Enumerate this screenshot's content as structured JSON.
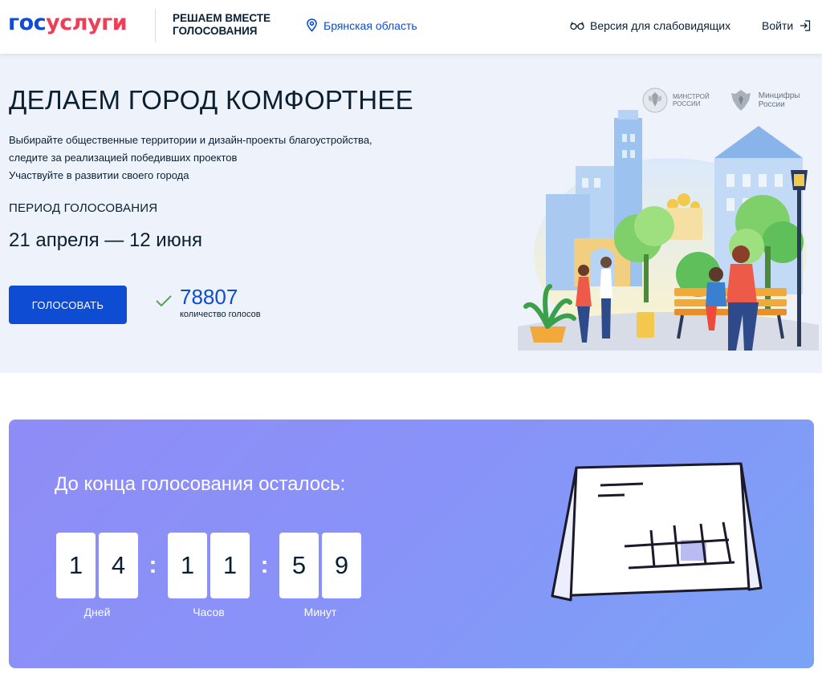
{
  "header": {
    "logo_part1": "гос",
    "logo_part2": "услуги",
    "project_line1": "РЕШАЕМ ВМЕСТЕ",
    "project_line2": "ГОЛОСОВАНИЯ",
    "region": "Брянская область",
    "low_vision": "Версия для слабовидящих",
    "login": "Войти"
  },
  "hero": {
    "title": "ДЕЛАЕМ ГОРОД КОМФОРТНЕЕ",
    "desc_line1": "Выбирайте общественные территории и дизайн-проекты благоустройства,",
    "desc_line2": "следите за реализацией победивших проектов",
    "desc_line3": "Участвуйте в развитии своего города",
    "period_label": "ПЕРИОД ГОЛОСОВАНИЯ",
    "period_value": "21 апреля — 12 июня",
    "vote_button": "ГОЛОСОВАТЬ",
    "votes_count": "78807",
    "votes_label": "количество голосов",
    "ministry1_line1": "МИНСТРОЙ",
    "ministry1_line2": "РОССИИ",
    "ministry2_line1": "Минцифры",
    "ministry2_line2": "России"
  },
  "countdown": {
    "title": "До конца голосования осталось:",
    "days": [
      "1",
      "4"
    ],
    "hours": [
      "1",
      "1"
    ],
    "minutes": [
      "5",
      "9"
    ],
    "days_label": "Дней",
    "hours_label": "Часов",
    "minutes_label": "Минут",
    "separator": ":"
  },
  "colors": {
    "brand_blue": "#0d4cd3",
    "brand_red": "#ee3f58",
    "hero_bg": "#eef2fb",
    "countdown_bg": "#8893f8"
  }
}
